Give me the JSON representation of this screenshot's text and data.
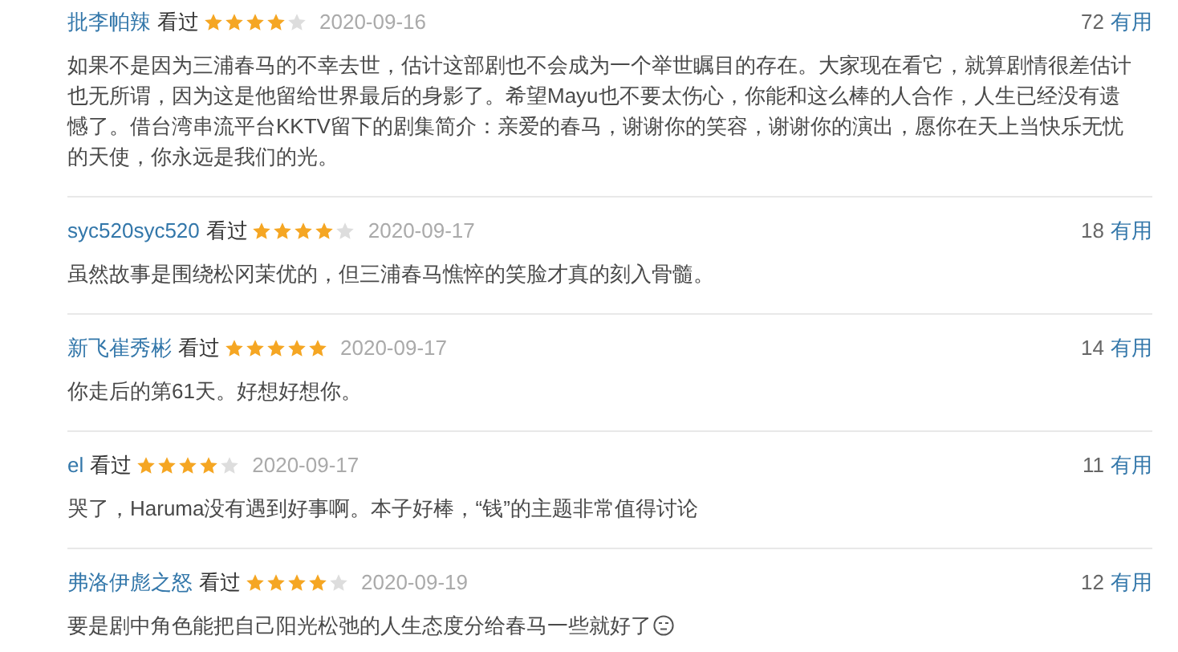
{
  "reviews": [
    {
      "user": "批李帕辣",
      "status": "看过",
      "stars": 4,
      "date": "2020-09-16",
      "votes": "72",
      "votes_label": "有用",
      "text": "如果不是因为三浦春马的不幸去世，估计这部剧也不会成为一个举世瞩目的存在。大家现在看它，就算剧情很差估计也无所谓，因为这是他留给世界最后的身影了。希望Mayu也不要太伤心，你能和这么棒的人合作，人生已经没有遗憾了。借台湾串流平台KKTV留下的剧集简介：亲爱的春马，谢谢你的笑容，谢谢你的演出，愿你在天上当快乐无忧的天使，你永远是我们的光。"
    },
    {
      "user": "syc520syc520",
      "status": "看过",
      "stars": 4,
      "date": "2020-09-17",
      "votes": "18",
      "votes_label": "有用",
      "text": "虽然故事是围绕松冈茉优的，但三浦春马憔悴的笑脸才真的刻入骨髓。"
    },
    {
      "user": "新飞崔秀彬",
      "status": "看过",
      "stars": 5,
      "date": "2020-09-17",
      "votes": "14",
      "votes_label": "有用",
      "text": "你走后的第61天。好想好想你。"
    },
    {
      "user": "el",
      "status": "看过",
      "stars": 4,
      "date": "2020-09-17",
      "votes": "11",
      "votes_label": "有用",
      "text": "哭了，Haruma没有遇到好事啊。本子好棒，“钱”的主题非常值得讨论"
    },
    {
      "user": "弗洛伊彪之怒",
      "status": "看过",
      "stars": 4,
      "date": "2020-09-19",
      "votes": "12",
      "votes_label": "有用",
      "text": "要是剧中角色能把自己阳光松弛的人生态度分给春马一些就好了",
      "emoji": true
    }
  ]
}
